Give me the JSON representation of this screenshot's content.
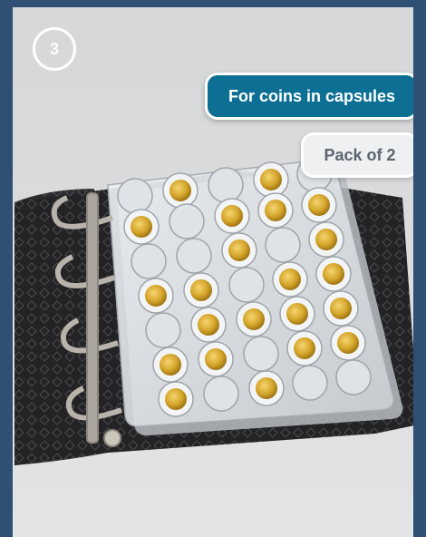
{
  "badge": {
    "number": "3"
  },
  "labels": {
    "primary": "For coins in capsules",
    "secondary": "Pack of 2"
  },
  "colors": {
    "outer_background": "#2f4f74",
    "panel_background": "#dcdddf",
    "primary_pill": "#0d6f94",
    "secondary_pill": "#eef0f2",
    "secondary_text": "#5b6670",
    "binder": "#1f1f21",
    "coin_gold": "#d4a52a"
  }
}
